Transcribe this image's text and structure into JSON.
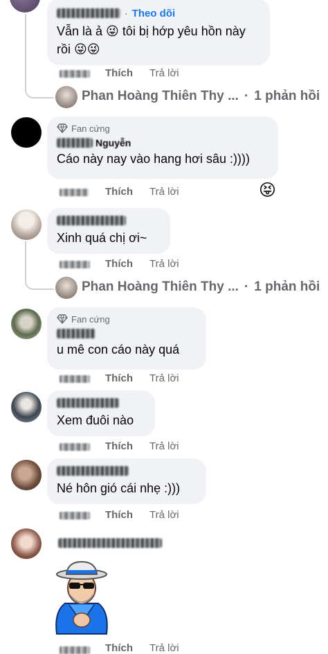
{
  "comments": [
    {
      "follow_label": "Theo dõi",
      "text": "Vẫn là ả 😜 tôi bị hớp yêu hồn này rồi 😜😜",
      "like": "Thích",
      "reply": "Trả lời",
      "thread": {
        "name": "Phan Hoàng Thiên Thy ...",
        "sep": "·",
        "count": "1 phản hồi"
      }
    },
    {
      "badge": "Fan cứng",
      "name_visible": "Nguyễn",
      "text": "Cáo này nay vào hang hơi sâu :))))",
      "like": "Thích",
      "reply": "Trả lời",
      "reaction": "😝"
    },
    {
      "text": "Xinh quá chị ơi~",
      "like": "Thích",
      "reply": "Trả lời",
      "thread": {
        "name": "Phan Hoàng Thiên Thy ...",
        "sep": "·",
        "count": "1 phản hồi"
      }
    },
    {
      "badge": "Fan cứng",
      "text": "u mê con cáo này quá",
      "like": "Thích",
      "reply": "Trả lời"
    },
    {
      "text": "Xem đuôi nào",
      "like": "Thích",
      "reply": "Trả lời"
    },
    {
      "text": "Né hôn gió cái nhẹ :)))",
      "like": "Thích",
      "reply": "Trả lời"
    },
    {
      "sticker": "old-man-sunglasses-sticker",
      "like": "Thích",
      "reply": "Trả lời"
    }
  ],
  "icons": {
    "badge_icon": "diamond-icon"
  },
  "colors": {
    "bubble": "#f0f2f5",
    "link": "#1877f2",
    "muted": "#65676b"
  }
}
